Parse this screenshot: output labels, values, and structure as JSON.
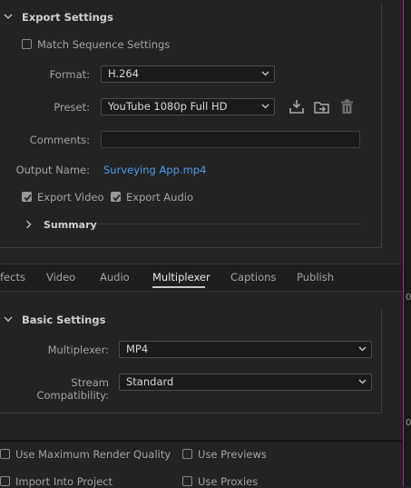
{
  "export_settings": {
    "title": "Export Settings",
    "match_sequence_label": "Match Sequence Settings",
    "match_sequence_checked": false,
    "format_label": "Format:",
    "format_value": "H.264",
    "preset_label": "Preset:",
    "preset_value": "YouTube 1080p Full HD",
    "comments_label": "Comments:",
    "comments_value": "",
    "output_name_label": "Output Name:",
    "output_name_value": "Surveying App.mp4",
    "export_video_label": "Export Video",
    "export_video_checked": true,
    "export_audio_label": "Export Audio",
    "export_audio_checked": true,
    "summary_label": "Summary"
  },
  "tabs": [
    {
      "label": "fects",
      "active": false
    },
    {
      "label": "Video",
      "active": false
    },
    {
      "label": "Audio",
      "active": false
    },
    {
      "label": "Multiplexer",
      "active": true
    },
    {
      "label": "Captions",
      "active": false
    },
    {
      "label": "Publish",
      "active": false
    }
  ],
  "basic_settings": {
    "title": "Basic Settings",
    "multiplexer_label": "Multiplexer:",
    "multiplexer_value": "MP4",
    "stream_compat_label": "Stream Compatibility:",
    "stream_compat_value": "Standard"
  },
  "footer": {
    "max_render_label": "Use Maximum Render Quality",
    "use_previews_label": "Use Previews",
    "import_label": "Import Into Project",
    "use_proxies_label": "Use Proxies"
  },
  "side_text": {
    "mid": "0",
    "bottom": "0"
  },
  "colors": {
    "background": "#232323",
    "link": "#4c9be8",
    "accent_line": "#b21fb2"
  }
}
